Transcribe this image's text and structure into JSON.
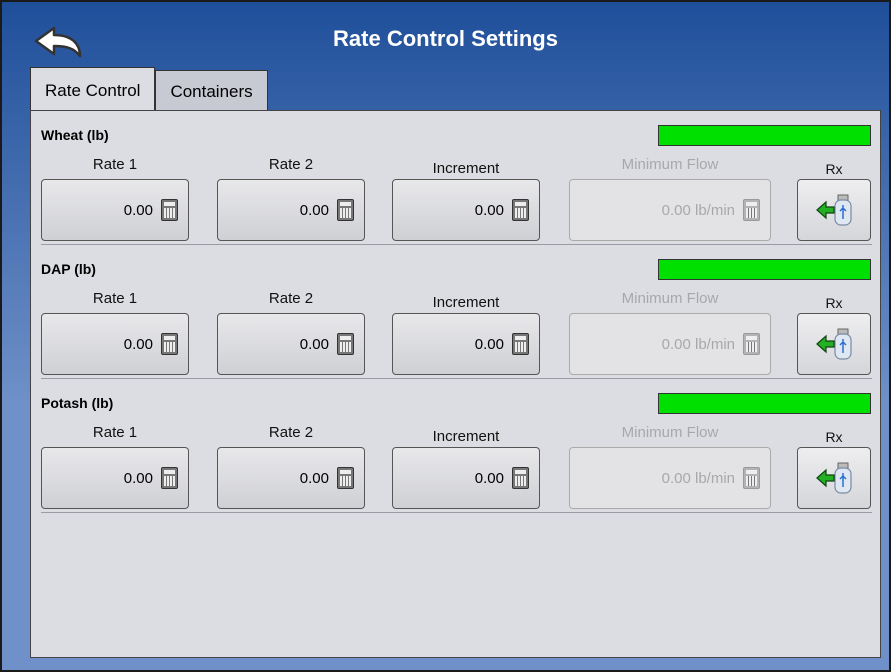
{
  "header": {
    "title": "Rate Control Settings"
  },
  "tabs": [
    {
      "label": "Rate Control"
    },
    {
      "label": "Containers"
    }
  ],
  "columns": {
    "rate1": "Rate 1",
    "rate2": "Rate 2",
    "increment": "Increment",
    "min_flow": "Minimum Flow",
    "rx": "Rx"
  },
  "products": [
    {
      "name": "Wheat (lb)",
      "rate1": "0.00",
      "rate2": "0.00",
      "increment": "0.00",
      "min_flow": "0.00 lb/min",
      "status_color": "#00e000"
    },
    {
      "name": "DAP (lb)",
      "rate1": "0.00",
      "rate2": "0.00",
      "increment": "0.00",
      "min_flow": "0.00 lb/min",
      "status_color": "#00e000"
    },
    {
      "name": "Potash (lb)",
      "rate1": "0.00",
      "rate2": "0.00",
      "increment": "0.00",
      "min_flow": "0.00 lb/min",
      "status_color": "#00e000"
    }
  ],
  "icons": {
    "back": "back-arrow-icon",
    "calculator": "calculator-icon",
    "rx": "usb-import-arrow-icon"
  }
}
